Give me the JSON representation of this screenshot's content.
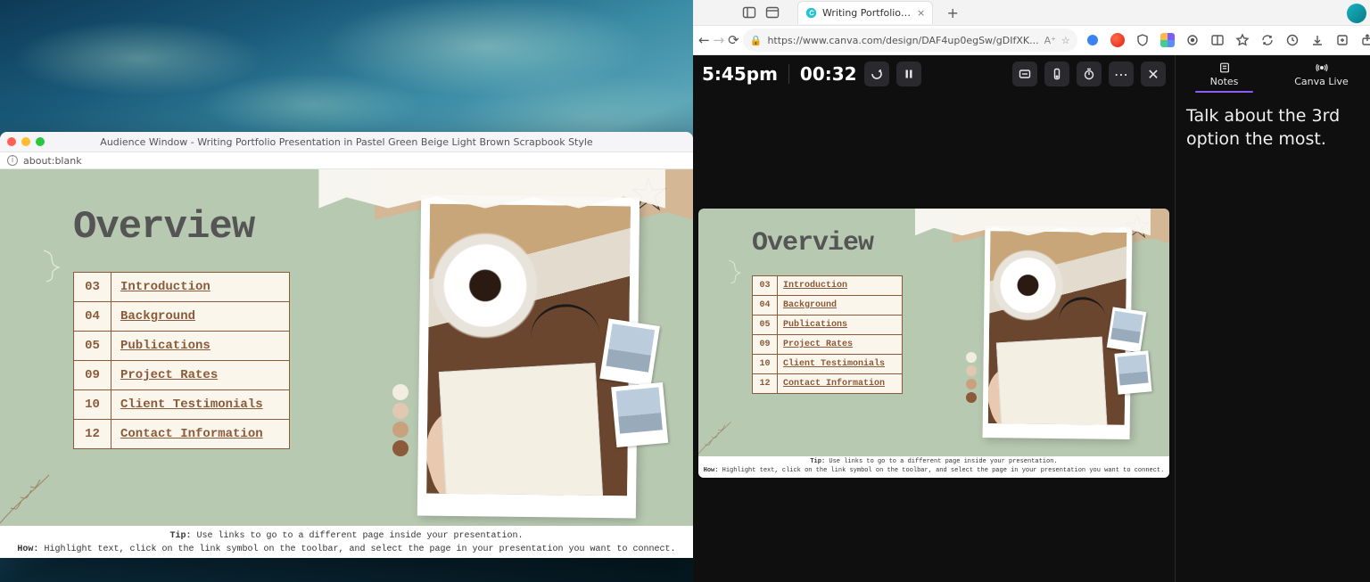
{
  "audience_window": {
    "title": "Audience Window - Writing Portfolio Presentation in Pastel Green Beige Light Brown Scrapbook Style",
    "address": "about:blank"
  },
  "browser": {
    "tab_title": "Writing Portfolio Presentation i",
    "url": "https://www.canva.com/design/DAF4up0egSw/gDIfXK...",
    "new_tab": "+"
  },
  "presenter": {
    "clock": "5:45pm",
    "elapsed": "00:32",
    "side_tabs": {
      "notes": "Notes",
      "live": "Canva Live"
    },
    "notes_text": "Talk about the 3rd option the most."
  },
  "slide": {
    "title": "Overview",
    "toc": [
      {
        "num": "03",
        "label": "Introduction"
      },
      {
        "num": "04",
        "label": "Background"
      },
      {
        "num": "05",
        "label": "Publications"
      },
      {
        "num": "09",
        "label": "Project Rates"
      },
      {
        "num": "10",
        "label": "Client Testimonials"
      },
      {
        "num": "12",
        "label": "Contact Information"
      }
    ],
    "palette": [
      "#b7c9b1",
      "#f2ede1",
      "#e2c8b0",
      "#c9a17c",
      "#8a5a3a"
    ],
    "tip_label": "Tip:",
    "tip_text": " Use links to go to a different page inside your presentation.",
    "how_label": "How:",
    "how_text": " Highlight text, click on the link symbol on the toolbar, and select the page in your presentation  you want to connect."
  }
}
